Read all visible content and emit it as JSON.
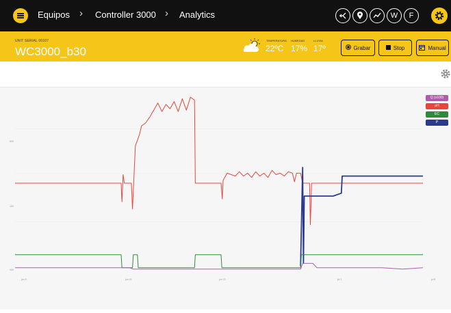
{
  "breadcrumb": {
    "item1": "Equipos",
    "item2": "Controller 3000",
    "item3": "Analytics"
  },
  "nav_icons": [
    "merge-icon",
    "location-pin-icon",
    "trend-icon",
    "W",
    "F"
  ],
  "header": {
    "serial_label": "UNIT SERIAL 00107",
    "device_name": "WC3000_b30",
    "weather": {
      "temperature_label": "TEMPERATURA",
      "temperature": "22ºC",
      "humidity_label": "HUMEDAD",
      "humidity": "17%",
      "rain_label": "LLUVIA",
      "rain": "17º"
    },
    "buttons": {
      "record": "Grabar",
      "stop": "Stop",
      "manual": "Manual"
    }
  },
  "colors": {
    "brand_yellow": "#f5c518",
    "topbar": "#111111"
  },
  "chart_data": {
    "type": "line",
    "legend": [
      "Q (x100)",
      "pH",
      "EC",
      "P"
    ],
    "legend_colors": [
      "#b05bb0",
      "#e8453c",
      "#2e8b3a",
      "#2b3a8f"
    ],
    "y_ticks": [
      "600",
      "150",
      "000"
    ],
    "x_ticks": [
      "jun 8",
      "jun 15",
      "jun 22",
      "jul 1",
      "jul 8"
    ],
    "series": [
      {
        "name": "pH",
        "color": "#e8453c",
        "values": [
          [
            0,
            6.2
          ],
          [
            0.26,
            6.2
          ],
          [
            0.262,
            4.9
          ],
          [
            0.265,
            6.8
          ],
          [
            0.268,
            6.2
          ],
          [
            0.285,
            6.2
          ],
          [
            0.288,
            4.4
          ],
          [
            0.295,
            8.8
          ],
          [
            0.305,
            9.6
          ],
          [
            0.31,
            10.2
          ],
          [
            0.32,
            10.4
          ],
          [
            0.33,
            10.8
          ],
          [
            0.34,
            11.3
          ],
          [
            0.35,
            11.8
          ],
          [
            0.36,
            11.2
          ],
          [
            0.37,
            11.7
          ],
          [
            0.38,
            11.4
          ],
          [
            0.39,
            11.9
          ],
          [
            0.4,
            11.2
          ],
          [
            0.41,
            12.1
          ],
          [
            0.42,
            11.3
          ],
          [
            0.43,
            12.2
          ],
          [
            0.44,
            12.0
          ],
          [
            0.442,
            6.2
          ],
          [
            0.505,
            6.2
          ],
          [
            0.508,
            5.1
          ],
          [
            0.51,
            6.4
          ],
          [
            0.52,
            6.9
          ],
          [
            0.53,
            6.8
          ],
          [
            0.54,
            6.7
          ],
          [
            0.55,
            7.0
          ],
          [
            0.56,
            6.7
          ],
          [
            0.57,
            6.9
          ],
          [
            0.58,
            6.6
          ],
          [
            0.59,
            7.0
          ],
          [
            0.6,
            6.7
          ],
          [
            0.61,
            6.9
          ],
          [
            0.62,
            6.6
          ],
          [
            0.63,
            7.1
          ],
          [
            0.64,
            6.8
          ],
          [
            0.65,
            6.9
          ],
          [
            0.66,
            6.7
          ],
          [
            0.67,
            7.0
          ],
          [
            0.68,
            6.9
          ],
          [
            0.685,
            6.3
          ],
          [
            0.69,
            6.9
          ],
          [
            0.7,
            6.9
          ],
          [
            0.705,
            6.2
          ],
          [
            0.722,
            6.2
          ],
          [
            0.724,
            3.3
          ],
          [
            0.727,
            6.2
          ],
          [
            1,
            6.2
          ]
        ]
      },
      {
        "name": "P",
        "color": "#2b3a8f",
        "values": [
          [
            0.7,
            0.4
          ],
          [
            0.705,
            7.3
          ],
          [
            0.707,
            0.6
          ],
          [
            0.709,
            5.3
          ],
          [
            0.74,
            5.3
          ],
          [
            0.78,
            5.3
          ],
          [
            0.8,
            5.5
          ],
          [
            0.802,
            6.7
          ],
          [
            0.81,
            6.7
          ],
          [
            0.9,
            6.7
          ],
          [
            1,
            6.7
          ]
        ]
      },
      {
        "name": "EC",
        "color": "#2e8b3a",
        "values": [
          [
            0,
            1.2
          ],
          [
            0.26,
            1.2
          ],
          [
            0.262,
            0.3
          ],
          [
            0.288,
            0.3
          ],
          [
            0.29,
            1.2
          ],
          [
            0.3,
            1.2
          ],
          [
            0.302,
            0.3
          ],
          [
            0.44,
            0.3
          ],
          [
            0.442,
            1.2
          ],
          [
            0.505,
            1.2
          ],
          [
            0.507,
            0.3
          ],
          [
            0.7,
            0.3
          ],
          [
            0.702,
            1.2
          ],
          [
            1,
            1.2
          ]
        ]
      },
      {
        "name": "Q (x100)",
        "color": "#b05bb0",
        "values": [
          [
            0,
            0.3
          ],
          [
            0.2,
            0.3
          ],
          [
            0.28,
            0.3
          ],
          [
            0.29,
            0.2
          ],
          [
            0.5,
            0.2
          ],
          [
            0.7,
            0.2
          ],
          [
            0.705,
            0.6
          ],
          [
            0.73,
            0.6
          ],
          [
            0.74,
            0.3
          ],
          [
            0.9,
            0.3
          ],
          [
            0.95,
            0.2
          ],
          [
            1,
            0.3
          ]
        ]
      }
    ]
  }
}
